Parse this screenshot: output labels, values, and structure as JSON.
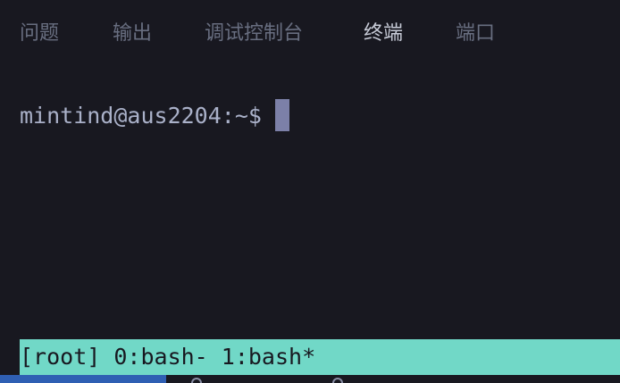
{
  "tabs": [
    {
      "label": "问题"
    },
    {
      "label": "输出"
    },
    {
      "label": "调试控制台"
    },
    {
      "label": "终端",
      "active": true
    },
    {
      "label": "端口"
    }
  ],
  "terminal": {
    "prompt": "mintind@aus2204:~$"
  },
  "tmux_status": {
    "text": "[root] 0:bash- 1:bash*"
  },
  "colors": {
    "background": "#181820",
    "status_bar": "#71d8c7",
    "cursor": "#7c80a8",
    "bottom_accent": "#2f5fb3"
  }
}
